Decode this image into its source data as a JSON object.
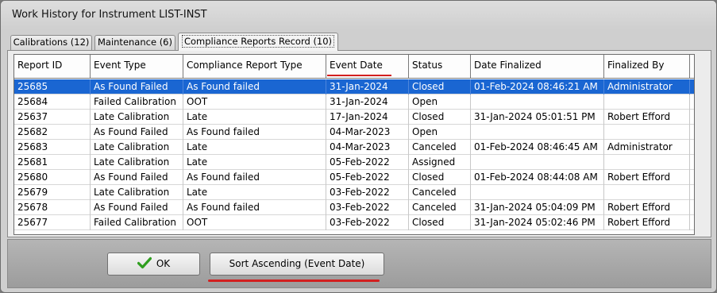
{
  "window": {
    "title": "Work History for Instrument LIST-INST"
  },
  "tabs": [
    {
      "label": "Calibrations (12)"
    },
    {
      "label": "Maintenance (6)"
    },
    {
      "label": "Compliance Reports Record (10)"
    }
  ],
  "table": {
    "columns": [
      "Report ID",
      "Event Type",
      "Compliance Report Type",
      "Event Date",
      "Status",
      "Date Finalized",
      "Finalized By"
    ],
    "rows": [
      [
        "25685",
        "As Found Failed",
        "As Found failed",
        "31-Jan-2024",
        "Closed",
        "01-Feb-2024 08:46:21 AM",
        "Administrator"
      ],
      [
        "25684",
        "Failed Calibration",
        "OOT",
        "31-Jan-2024",
        "Open",
        "",
        ""
      ],
      [
        "25637",
        "Late Calibration",
        "Late",
        "17-Jan-2024",
        "Closed",
        "31-Jan-2024 05:01:51 PM",
        "Robert Efford"
      ],
      [
        "25682",
        "As Found Failed",
        "As Found failed",
        "04-Mar-2023",
        "Open",
        "",
        ""
      ],
      [
        "25683",
        "Late Calibration",
        "Late",
        "04-Mar-2023",
        "Canceled",
        "01-Feb-2024 08:46:45 AM",
        "Administrator"
      ],
      [
        "25681",
        "Late Calibration",
        "Late",
        "05-Feb-2022",
        "Assigned",
        "",
        ""
      ],
      [
        "25680",
        "As Found Failed",
        "As Found failed",
        "05-Feb-2022",
        "Closed",
        "01-Feb-2024 08:44:08 AM",
        "Robert Efford"
      ],
      [
        "25679",
        "Late Calibration",
        "Late",
        "03-Feb-2022",
        "Canceled",
        "",
        ""
      ],
      [
        "25678",
        "As Found Failed",
        "As Found failed",
        "03-Feb-2022",
        "Canceled",
        "31-Jan-2024 05:04:09 PM",
        "Robert Efford"
      ],
      [
        "25677",
        "Failed Calibration",
        "OOT",
        "03-Feb-2022",
        "Closed",
        "31-Jan-2024 05:02:46 PM",
        "Robert Efford"
      ]
    ]
  },
  "buttons": {
    "ok_label": "OK",
    "sort_label": "Sort Ascending (Event Date)"
  },
  "icons": {
    "ok": "checkmark-icon"
  },
  "colors": {
    "selection": "#1a66d2",
    "annotation": "#d21f1f",
    "check": "#2f9e1f"
  }
}
